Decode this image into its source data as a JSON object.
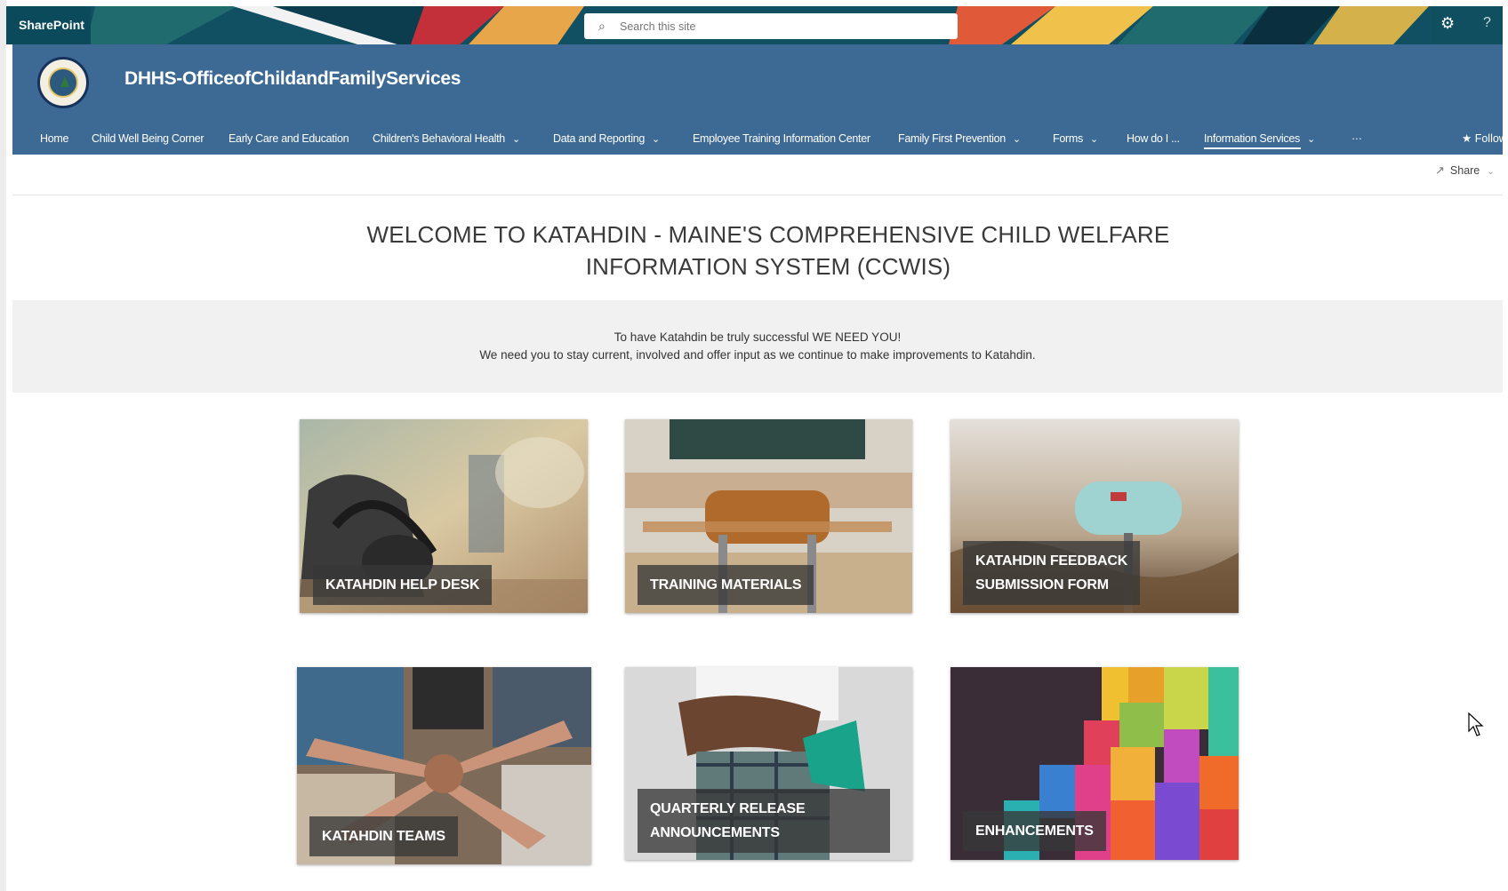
{
  "suitebar": {
    "brand": "SharePoint",
    "search_placeholder": "Search this site",
    "icons": {
      "search": "search-icon",
      "settings": "gear-icon",
      "help": "help-icon"
    }
  },
  "site": {
    "title": "DHHS-OfficeofChildandFamilyServices",
    "logo": "maine-state-seal"
  },
  "nav": {
    "items": [
      {
        "label": "Home",
        "dropdown": false
      },
      {
        "label": "Child Well Being Corner",
        "dropdown": false
      },
      {
        "label": "Early Care and Education",
        "dropdown": false
      },
      {
        "label": "Children's Behavioral Health",
        "dropdown": true
      },
      {
        "label": "Data and Reporting",
        "dropdown": true
      },
      {
        "label": "Employee Training Information Center",
        "dropdown": false
      },
      {
        "label": "Family First Prevention",
        "dropdown": true
      },
      {
        "label": "Forms",
        "dropdown": true
      },
      {
        "label": "How do I ...",
        "dropdown": false
      },
      {
        "label": "Information Services",
        "dropdown": true,
        "active": true
      }
    ],
    "more": "···",
    "follow": "Follow"
  },
  "command": {
    "share": "Share"
  },
  "hero": {
    "line1": "WELCOME TO KATAHDIN - MAINE'S COMPREHENSIVE CHILD WELFARE",
    "line2": "INFORMATION SYSTEM (CCWIS)"
  },
  "banner": {
    "line1": "To have Katahdin be truly successful WE NEED YOU!",
    "line2": "We need you to stay current, involved and offer input as we continue to make improvements to Katahdin."
  },
  "tiles": [
    {
      "caption": "KATAHDIN HELP DESK",
      "image": "headset-phone-photo"
    },
    {
      "caption": "TRAINING MATERIALS",
      "image": "classroom-chair-photo"
    },
    {
      "caption_line1": "KATAHDIN FEEDBACK",
      "caption_line2": "SUBMISSION FORM",
      "image": "mailbox-photo"
    },
    {
      "caption": "KATAHDIN TEAMS",
      "image": "team-hands-photo"
    },
    {
      "caption_line1": "QUARTERLY RELEASE",
      "caption_line2": "ANNOUNCEMENTS",
      "image": "megaphone-photo"
    },
    {
      "caption": "ENHANCEMENTS",
      "image": "colorful-blocks-photo"
    }
  ],
  "colors": {
    "suitebar": "#0f4f60",
    "site_header": "#3d6a94",
    "band": "#f1f1f1",
    "caption_bg": "#373737"
  }
}
